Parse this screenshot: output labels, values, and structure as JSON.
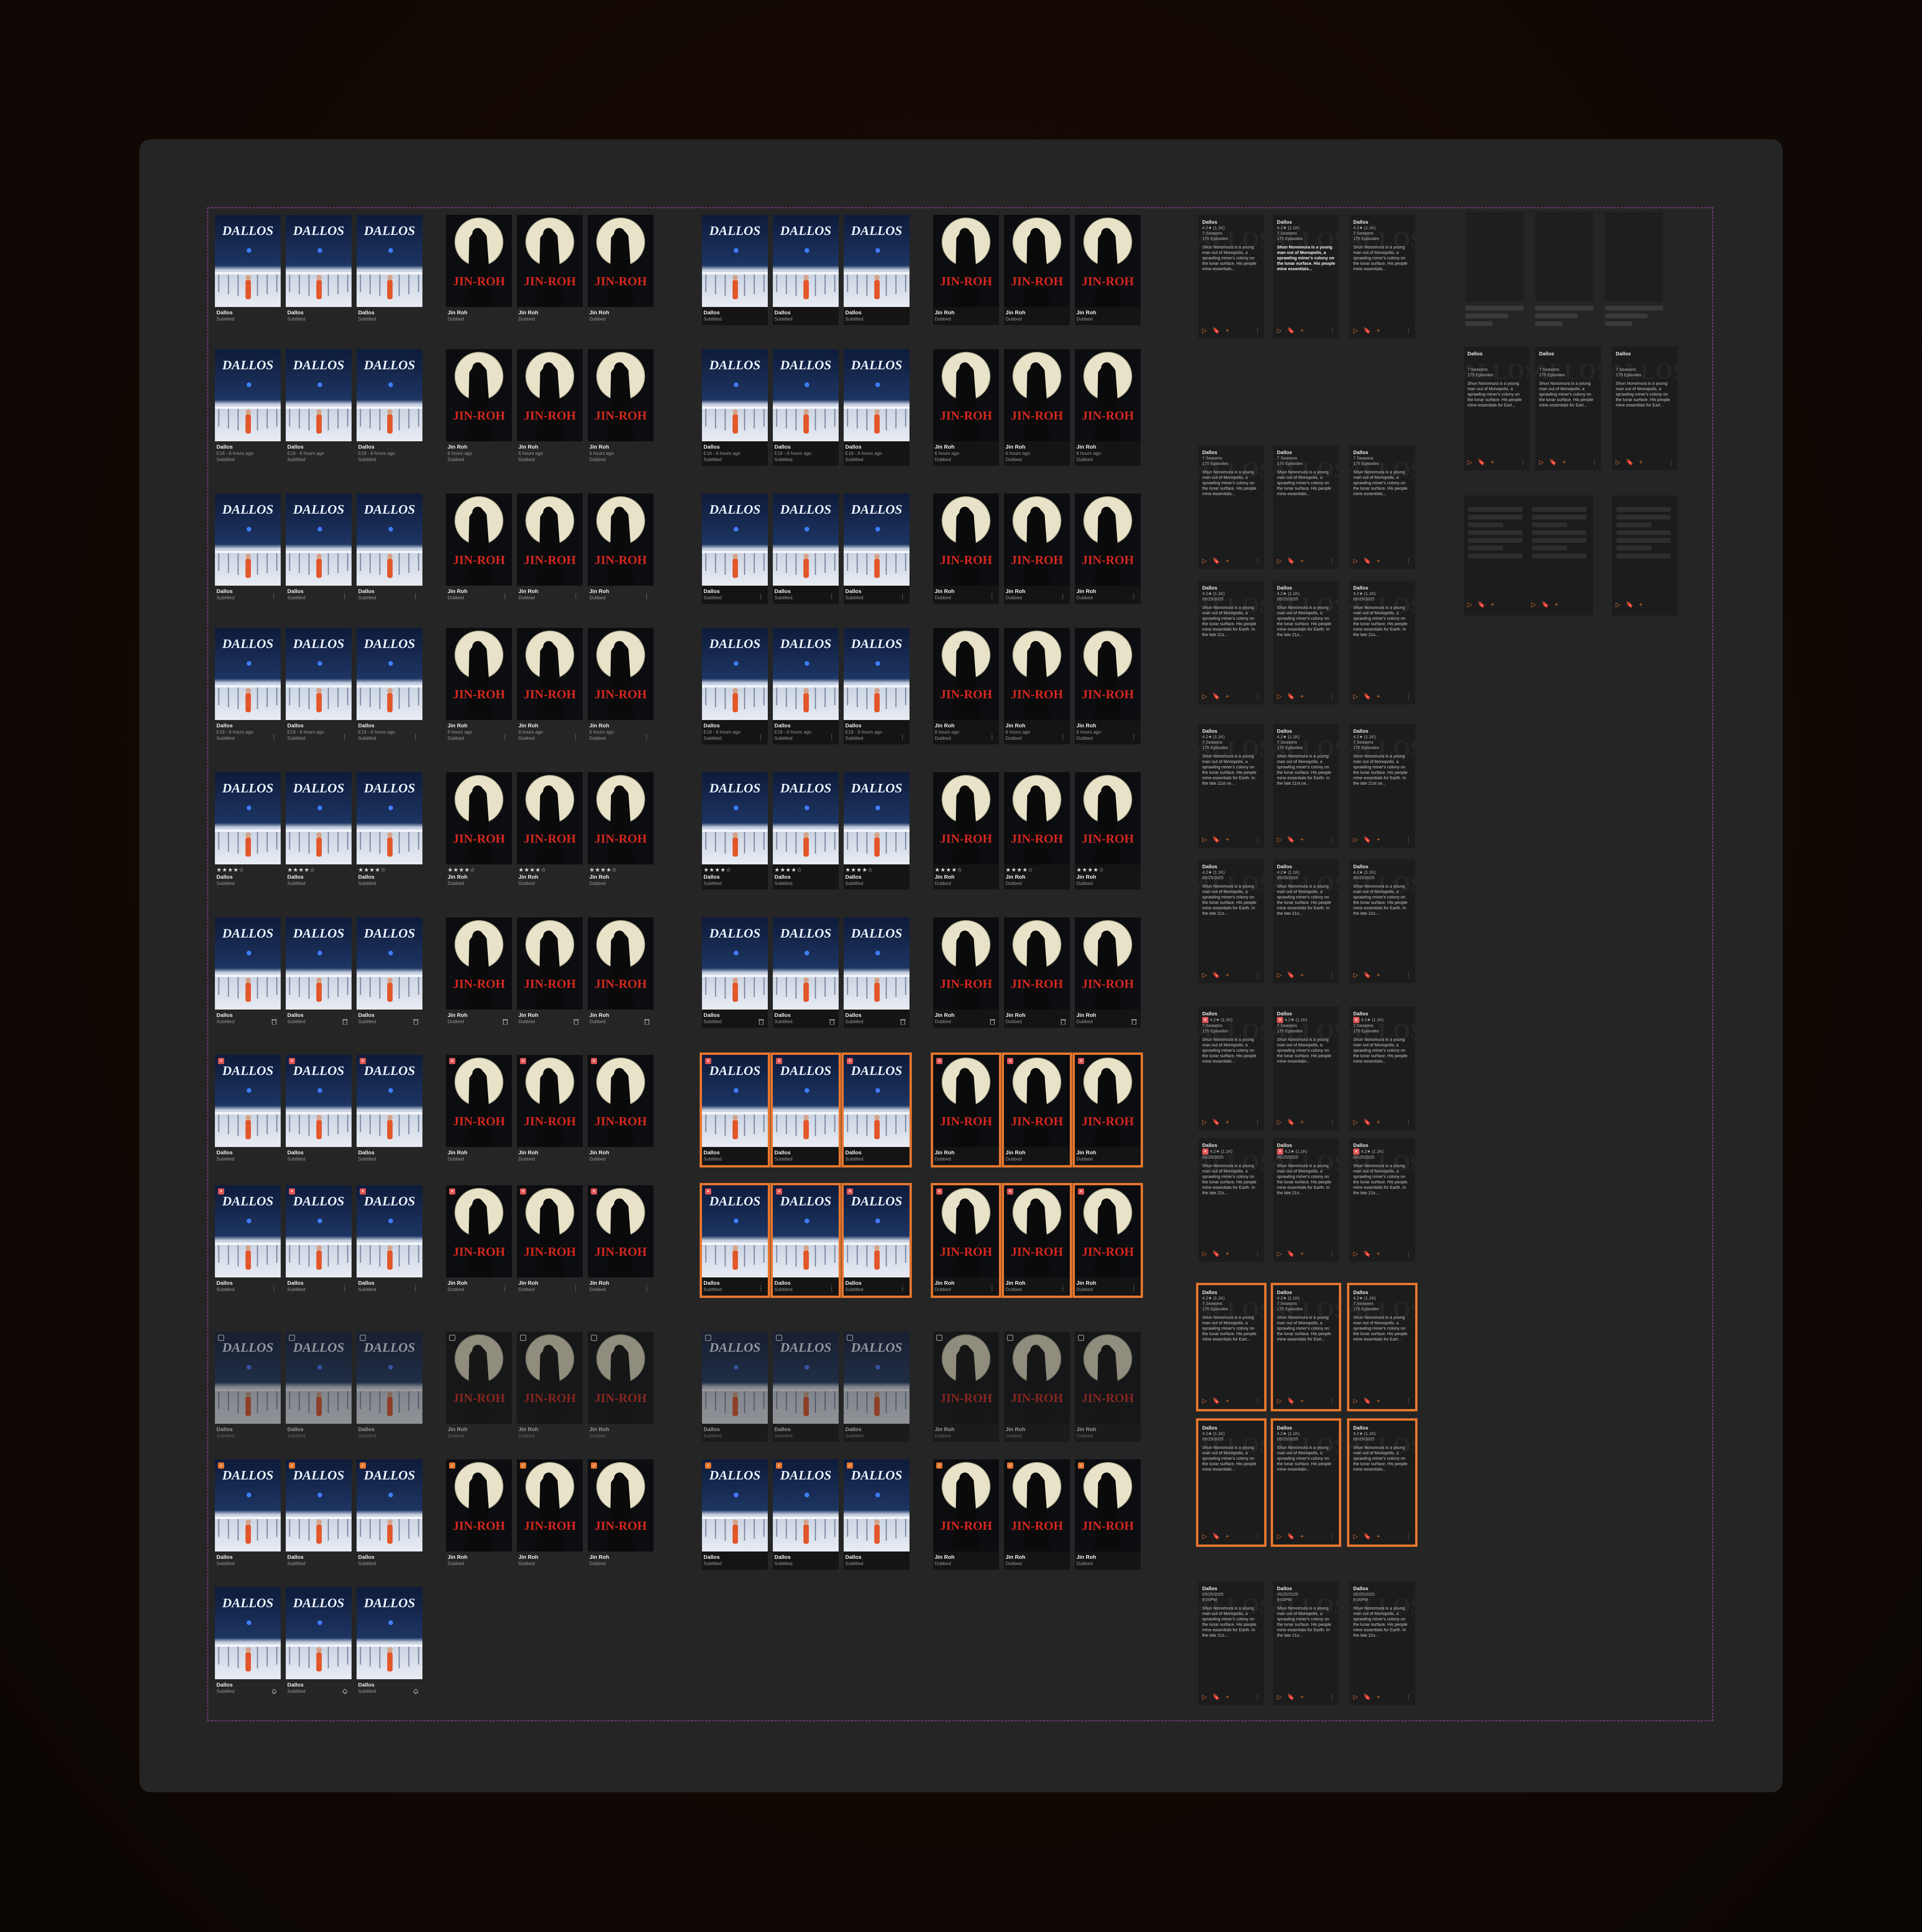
{
  "board": {
    "background": "#252525",
    "guide_color": "#6b3a6b"
  },
  "colors": {
    "accent": "#e8772e",
    "rating_star": "#f2c94c",
    "badge": "#e05555"
  },
  "shows": {
    "dallos": {
      "title": "Dallos",
      "type": "Subtitled",
      "episode": "E18 - 6 hours ago",
      "poster": "dallos-poster"
    },
    "jinroh": {
      "title": "Jin Roh",
      "type": "Dubbed",
      "episode": "6 hours ago",
      "poster": "jinroh-poster"
    }
  },
  "poster_text": {
    "dallos_logo": "DALLOS",
    "jinroh_logo": "JIN-ROH",
    "watermark": "DALLOS"
  },
  "star_rating": "★★★★☆",
  "hover_cards": {
    "title": "Dallos",
    "rating": "4.2★ (1.1K)",
    "seasons": "7 Seasons",
    "episodes": "175 Episodes",
    "date": "05/25/2025",
    "time": "9:00PM",
    "desc_a": "Shun Nonomura is a young man out of Monopolis, a sprawling miner's colony on the lunar surface. His people mine essentials...",
    "desc_b": "Shun Nonomura is a young man out of Monopolis, a sprawling miner's colony on the lunar surface. His people mine essentials for Eart...",
    "desc_c": "Shun Nonomura is a young man out of Monopolis, a sprawling miner's colony on the lunar surface. His people mine essentials for Earth. In the late 21st ce...",
    "desc_d": "Shun Nonomura is a young man out of Monopolis, a sprawling miner's colony on the lunar surface. His people mine essentials for Earth. In the late 21s...",
    "icons": [
      "play-icon",
      "bookmark-icon",
      "plus-icon",
      "more-icon"
    ]
  },
  "glyphs": {
    "play": "▷",
    "bookmark": "🔖",
    "plus": "+",
    "more": "⋮",
    "check": "✓",
    "badge": "✕"
  }
}
